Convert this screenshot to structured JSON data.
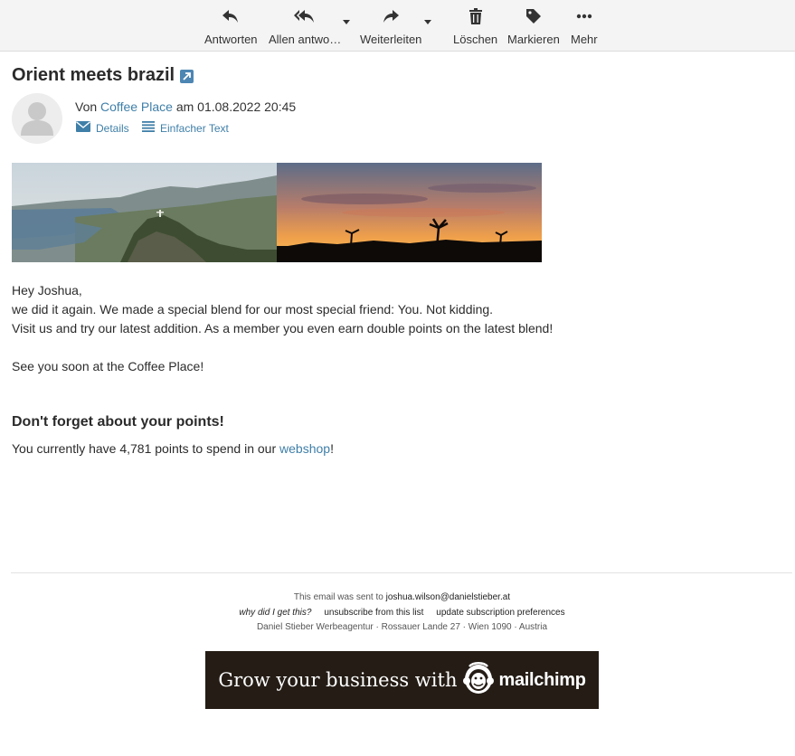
{
  "toolbar": {
    "reply": "Antworten",
    "reply_all": "Allen antwo…",
    "forward": "Weiterleiten",
    "delete": "Löschen",
    "flag": "Markieren",
    "more": "Mehr"
  },
  "message": {
    "subject": "Orient meets brazil",
    "from_prefix": "Von",
    "sender": "Coffee Place",
    "date_text": "am 01.08.2022 20:45",
    "details": "Details",
    "plain_text": "Einfacher Text"
  },
  "body": {
    "greeting": "Hey Joshua,",
    "line1": "we did it again. We made a special blend for our most special friend: You. Not kidding.",
    "line2": "Visit us and try our latest addition. As a member you even earn double points on the latest blend!",
    "line3": "See you soon at the Coffee Place!",
    "points_heading": "Don't forget about your points!",
    "points_prefix": "You currently have 4,781 points to spend in our",
    "points_link": "webshop",
    "points_suffix": "!"
  },
  "footer": {
    "sent_to_prefix": "This email was sent to",
    "sent_to_email": "joshua.wilson@danielstieber.at",
    "why": "why did I get this?",
    "unsubscribe": "unsubscribe from this list",
    "update_prefs": "update subscription preferences",
    "address": "Daniel Stieber Werbeagentur · Rossauer Lande 27 · Wien 1090 · Austria"
  },
  "mailchimp": {
    "tagline": "Grow your business with",
    "brand": "mailchimp"
  },
  "colors": {
    "link": "#3f7fa8",
    "toolbar_bg": "#f4f4f4",
    "mailchimp_bg": "#241c15"
  }
}
